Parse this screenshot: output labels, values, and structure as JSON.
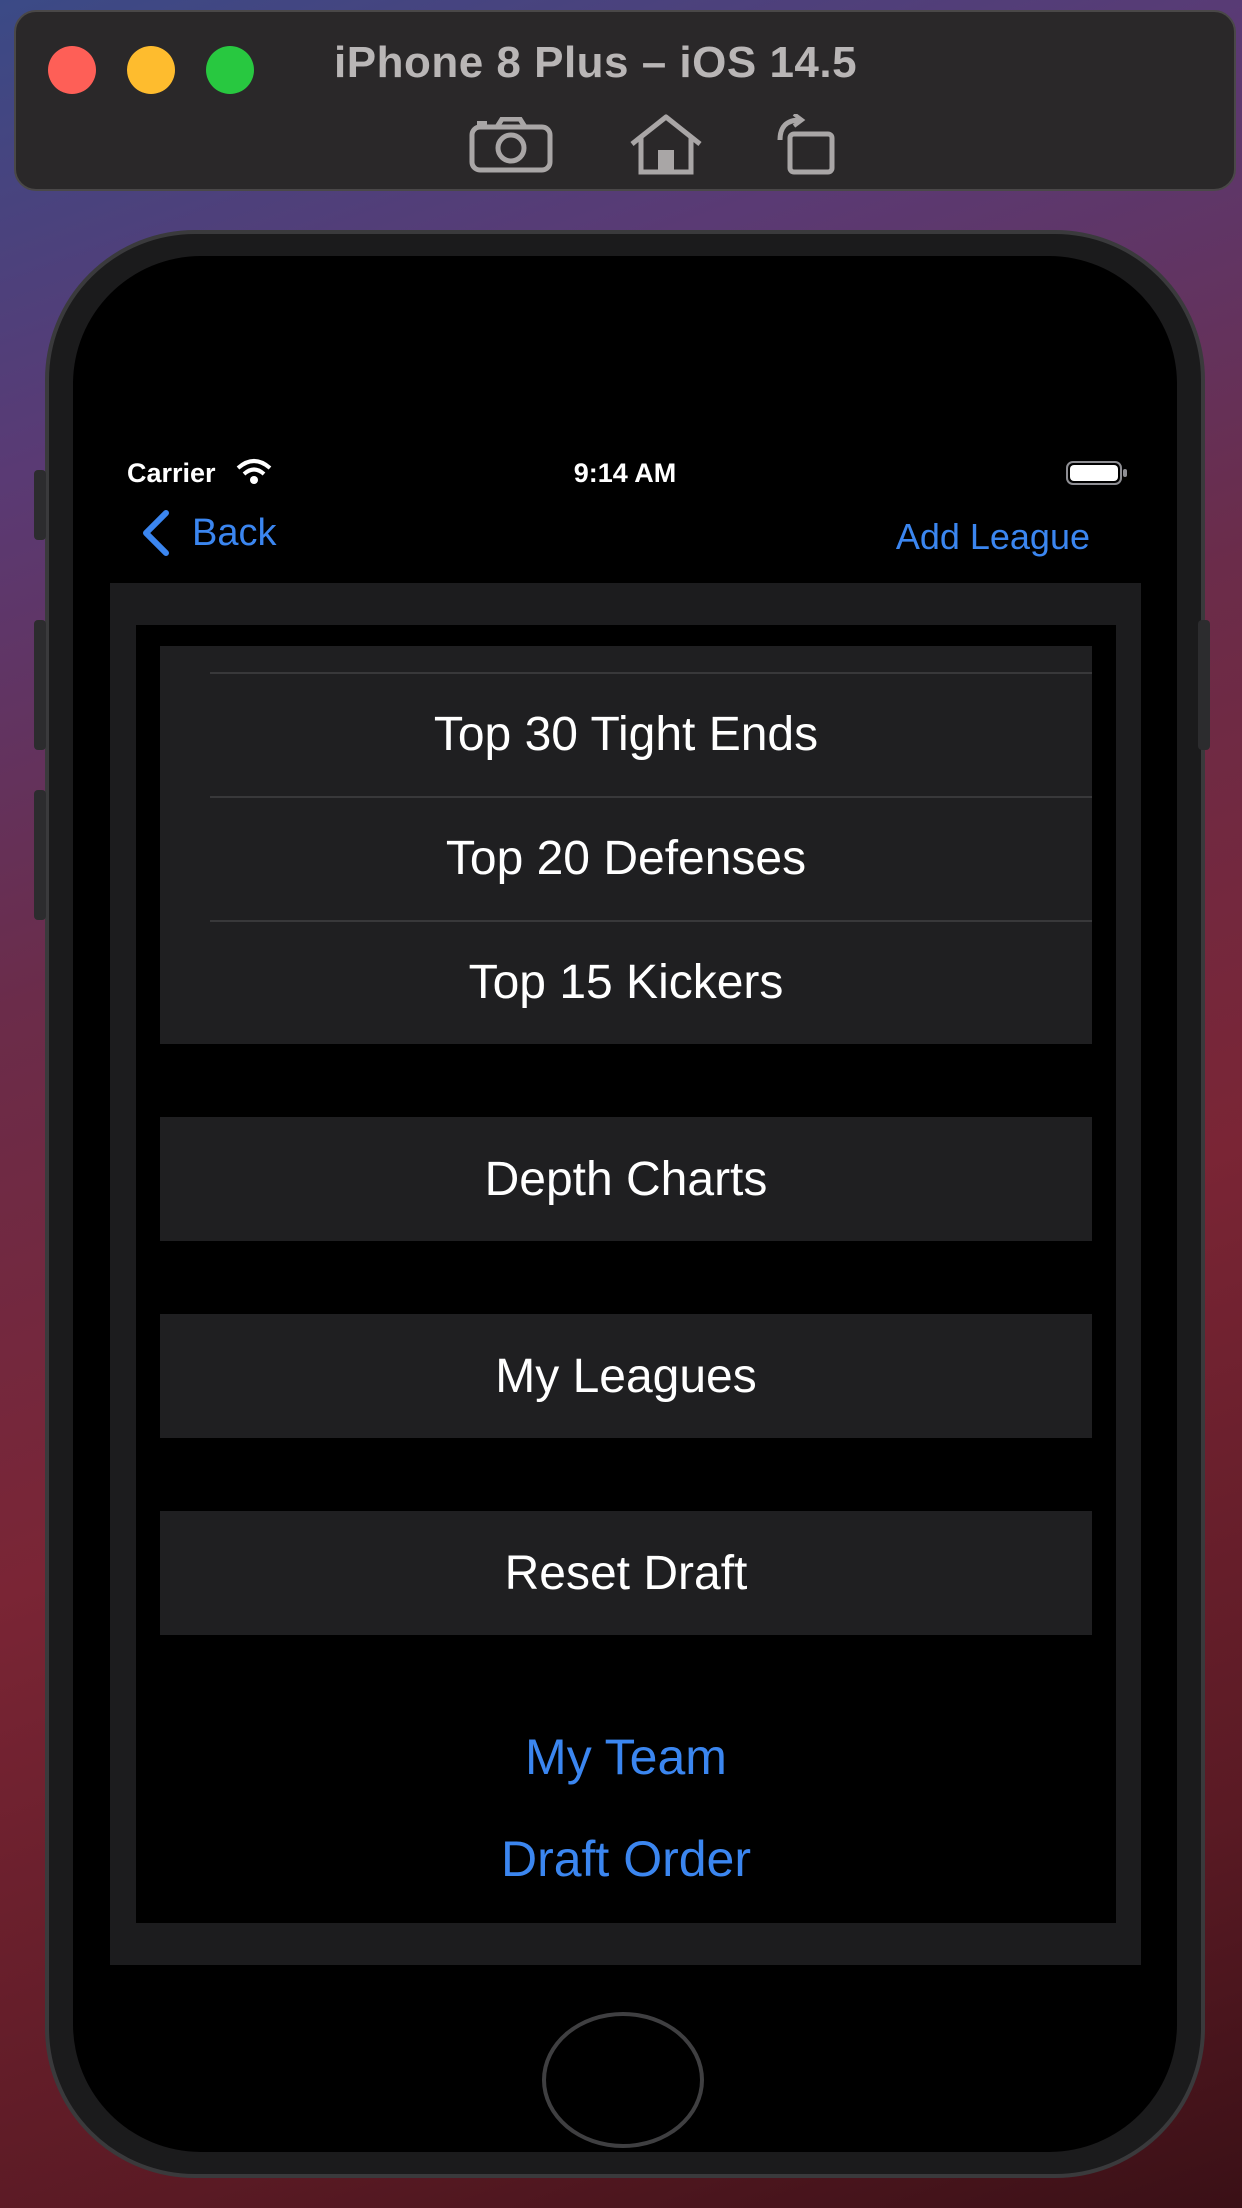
{
  "simulator": {
    "title": "iPhone 8 Plus – iOS 14.5",
    "icons": [
      "camera-icon",
      "home-icon",
      "rotate-icon"
    ]
  },
  "status_bar": {
    "carrier": "Carrier",
    "time": "9:14 AM"
  },
  "nav": {
    "back_label": "Back",
    "add_label": "Add League"
  },
  "rankings": {
    "items": [
      "Top 30 Tight Ends",
      "Top 20 Defenses",
      "Top 15 Kickers"
    ]
  },
  "menu": {
    "depth_charts": "Depth Charts",
    "my_leagues": "My Leagues",
    "reset_draft": "Reset Draft"
  },
  "links": {
    "my_team": "My Team",
    "draft_order": "Draft Order"
  },
  "colors": {
    "accent": "#3b86f0",
    "cell_background": "#1f1f21",
    "screen_background": "#000000"
  }
}
